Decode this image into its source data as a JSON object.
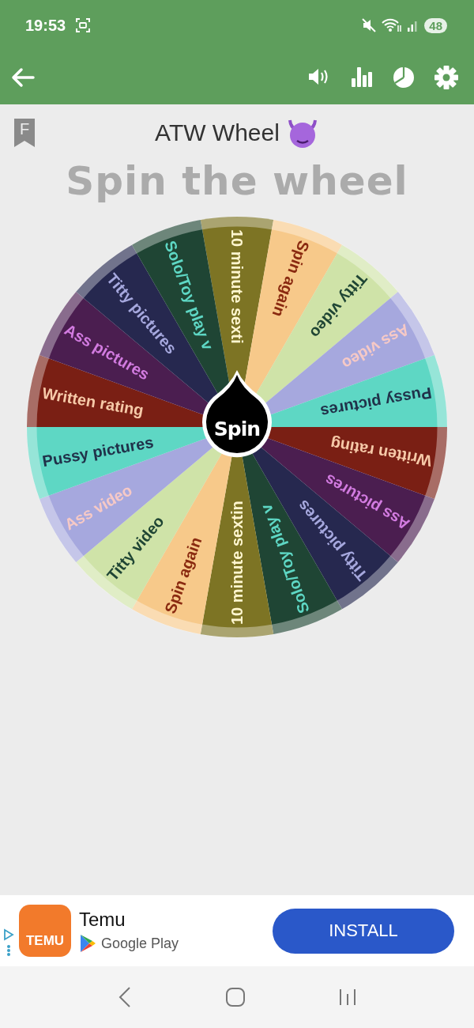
{
  "status_bar": {
    "time": "19:53",
    "battery": "48"
  },
  "app_bar": {
    "actions": [
      {
        "kind": "sound"
      },
      {
        "kind": "stats"
      },
      {
        "kind": "pie"
      },
      {
        "kind": "settings"
      }
    ]
  },
  "badge": "F",
  "title": "ATW Wheel",
  "heading": "Spin the wheel",
  "wheel": {
    "button": "Spin",
    "segments": [
      {
        "label": "10 minute sexti",
        "color": "#7d7424"
      },
      {
        "label": "Spin again",
        "color": "#f7c98a"
      },
      {
        "label": "Titty video",
        "color": "#cfe3a8"
      },
      {
        "label": "Ass video",
        "color": "#a6a8de"
      },
      {
        "label": "Pussy pictures",
        "color": "#5ed7c4"
      },
      {
        "label": "Written rating",
        "color": "#7a1f14"
      },
      {
        "label": "Ass pictures",
        "color": "#4b1e50"
      },
      {
        "label": "Titty pictures",
        "color": "#26284f"
      },
      {
        "label": "Solo/Toy play v",
        "color": "#1f4534"
      },
      {
        "label": "10 minute sextin",
        "color": "#7d7424"
      },
      {
        "label": "Spin again",
        "color": "#f7c98a"
      },
      {
        "label": "Titty video",
        "color": "#cfe3a8"
      },
      {
        "label": "Ass video",
        "color": "#a6a8de"
      },
      {
        "label": "Pussy pictures",
        "color": "#5ed7c4"
      },
      {
        "label": "Written rating",
        "color": "#7a1f14"
      },
      {
        "label": "Ass pictures",
        "color": "#4b1e50"
      },
      {
        "label": "Titty pictures",
        "color": "#26284f"
      },
      {
        "label": "Solo/Toy play v",
        "color": "#1f4534"
      }
    ]
  },
  "ad": {
    "logo": "TEMU",
    "name": "Temu",
    "store": "Google Play",
    "button": "INSTALL"
  }
}
